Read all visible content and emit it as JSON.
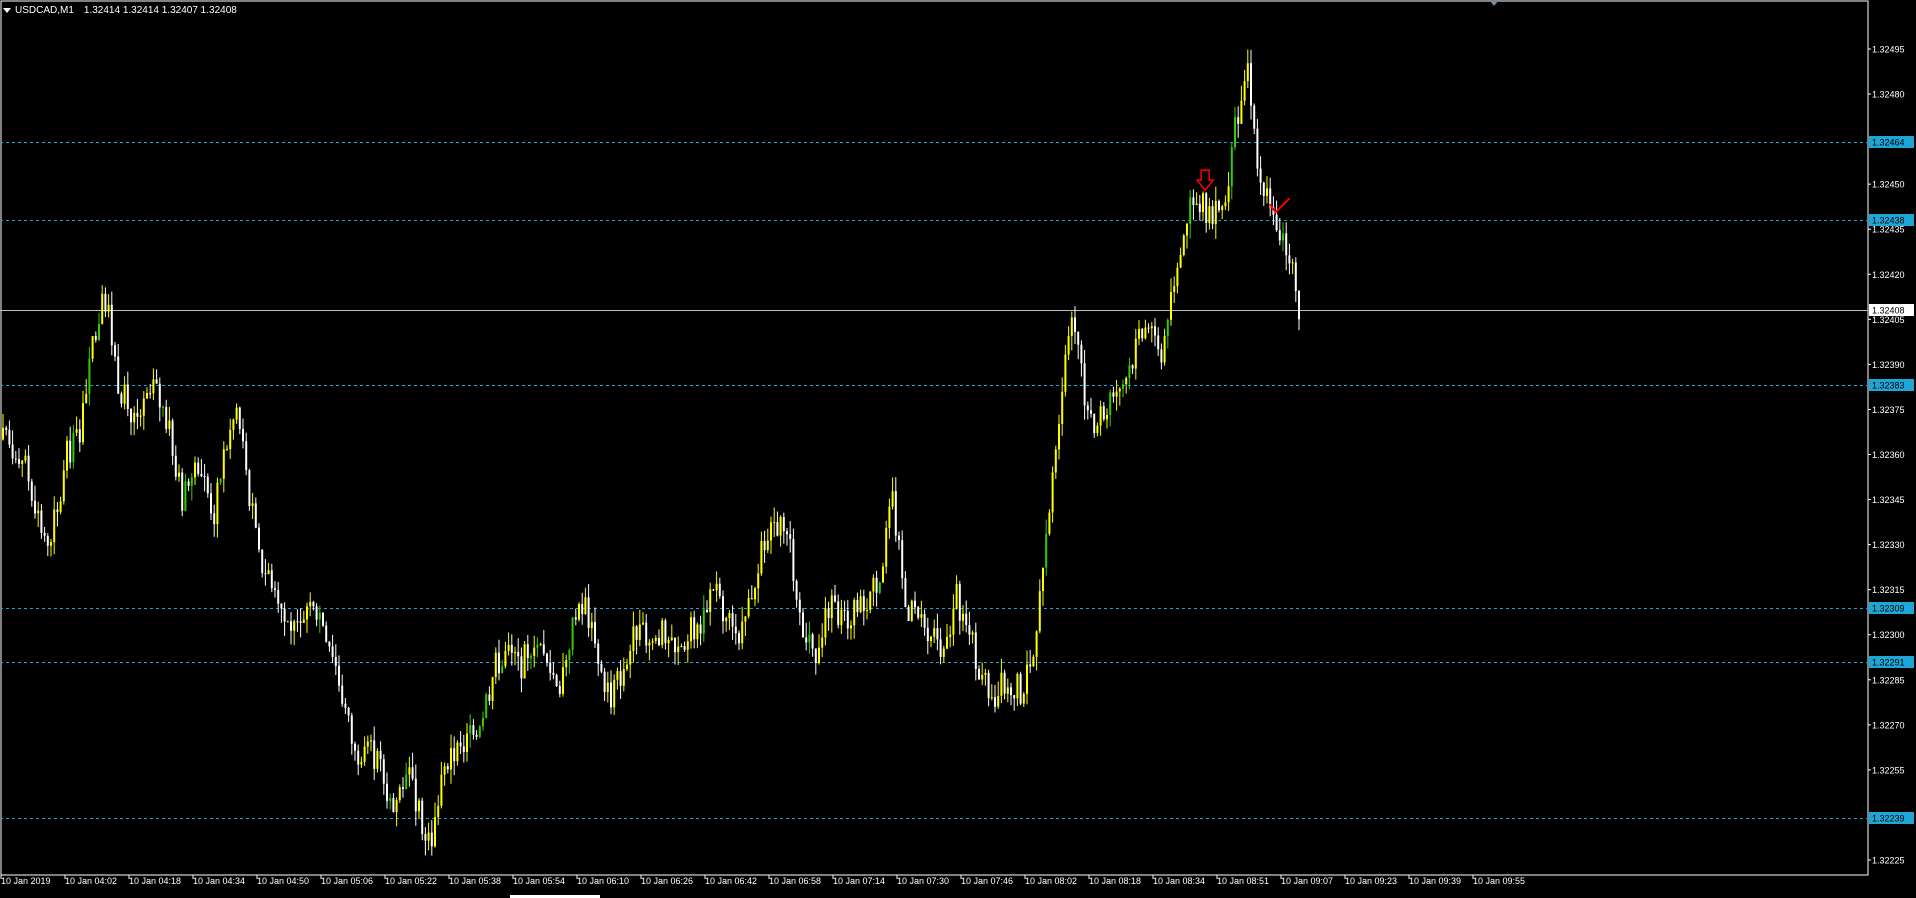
{
  "chart": {
    "symbol_tf": "USDCAD,M1",
    "quote": "1.32414 1.32414 1.32407 1.32408",
    "colors": {
      "background": "#000000",
      "frame": "#ffffff",
      "text": "#ffffff",
      "bull": "#ffff00",
      "bull_alt": "#33cc00",
      "bear": "#ffffff",
      "level_line": "#1ea7d6",
      "level_label_bg": "#1ea7d6",
      "level_label_text": "#000000",
      "current_line": "#bfbfbf",
      "arrow": "#ff0000"
    },
    "price_axis": [
      "1.32495",
      "1.32480",
      "1.32450",
      "1.32435",
      "1.32420",
      "1.32405",
      "1.32390",
      "1.32375",
      "1.32360",
      "1.32345",
      "1.32330",
      "1.32315",
      "1.32300",
      "1.32285",
      "1.32270",
      "1.32255",
      "1.32225"
    ],
    "levels": [
      {
        "label": "1.32464",
        "price": 1.32464
      },
      {
        "label": "1.32438",
        "price": 1.32438
      },
      {
        "label": "1.32383",
        "price": 1.32383
      },
      {
        "label": "1.32309",
        "price": 1.32309
      },
      {
        "label": "1.32291",
        "price": 1.32291
      },
      {
        "label": "1.32239",
        "price": 1.32239
      }
    ],
    "current_price": {
      "label": "1.32408",
      "price": 1.32408
    },
    "time_axis": [
      "10 Jan 2019",
      "10 Jan 04:02",
      "10 Jan 04:18",
      "10 Jan 04:34",
      "10 Jan 04:50",
      "10 Jan 05:06",
      "10 Jan 05:22",
      "10 Jan 05:38",
      "10 Jan 05:54",
      "10 Jan 06:10",
      "10 Jan 06:26",
      "10 Jan 06:42",
      "10 Jan 06:58",
      "10 Jan 07:14",
      "10 Jan 07:30",
      "10 Jan 07:46",
      "10 Jan 08:02",
      "10 Jan 08:18",
      "10 Jan 08:34",
      "10 Jan 08:51",
      "10 Jan 09:07",
      "10 Jan 09:23",
      "10 Jan 09:39",
      "10 Jan 09:55"
    ],
    "price_path": [
      [
        0,
        1.32365
      ],
      [
        6,
        1.3236
      ],
      [
        10,
        1.32345
      ],
      [
        13,
        1.3233
      ],
      [
        17,
        1.3234
      ],
      [
        20,
        1.3236
      ],
      [
        24,
        1.32368
      ],
      [
        28,
        1.324
      ],
      [
        32,
        1.32412
      ],
      [
        36,
        1.32385
      ],
      [
        40,
        1.32372
      ],
      [
        44,
        1.32375
      ],
      [
        47,
        1.32383
      ],
      [
        51,
        1.32372
      ],
      [
        56,
        1.32345
      ],
      [
        61,
        1.32358
      ],
      [
        66,
        1.3234
      ],
      [
        69,
        1.3236
      ],
      [
        73,
        1.32375
      ],
      [
        76,
        1.32355
      ],
      [
        80,
        1.32325
      ],
      [
        85,
        1.32318
      ],
      [
        88,
        1.32305
      ],
      [
        92,
        1.323
      ],
      [
        96,
        1.32315
      ],
      [
        100,
        1.32305
      ],
      [
        103,
        1.32295
      ],
      [
        106,
        1.3228
      ],
      [
        110,
        1.3226
      ],
      [
        114,
        1.32265
      ],
      [
        118,
        1.32255
      ],
      [
        122,
        1.32242
      ],
      [
        126,
        1.32255
      ],
      [
        130,
        1.3224
      ],
      [
        134,
        1.32232
      ],
      [
        138,
        1.32255
      ],
      [
        142,
        1.32262
      ],
      [
        146,
        1.32265
      ],
      [
        150,
        1.32275
      ],
      [
        154,
        1.3229
      ],
      [
        158,
        1.32295
      ],
      [
        162,
        1.3229
      ],
      [
        166,
        1.323
      ],
      [
        170,
        1.3229
      ],
      [
        174,
        1.32284
      ],
      [
        178,
        1.32303
      ],
      [
        182,
        1.3231
      ],
      [
        186,
        1.3229
      ],
      [
        190,
        1.3228
      ],
      [
        194,
        1.3229
      ],
      [
        198,
        1.32302
      ],
      [
        202,
        1.32298
      ],
      [
        206,
        1.323
      ],
      [
        210,
        1.32293
      ],
      [
        214,
        1.323
      ],
      [
        218,
        1.32305
      ],
      [
        222,
        1.32316
      ],
      [
        226,
        1.32305
      ],
      [
        230,
        1.32295
      ],
      [
        234,
        1.32315
      ],
      [
        238,
        1.3233
      ],
      [
        242,
        1.32336
      ],
      [
        246,
        1.3233
      ],
      [
        250,
        1.323
      ],
      [
        254,
        1.32295
      ],
      [
        258,
        1.3231
      ],
      [
        262,
        1.32305
      ],
      [
        266,
        1.32308
      ],
      [
        270,
        1.32312
      ],
      [
        274,
        1.3232
      ],
      [
        278,
        1.32345
      ],
      [
        282,
        1.3231
      ],
      [
        286,
        1.32306
      ],
      [
        290,
        1.323
      ],
      [
        294,
        1.32292
      ],
      [
        298,
        1.32312
      ],
      [
        302,
        1.323
      ],
      [
        306,
        1.32286
      ],
      [
        310,
        1.3228
      ],
      [
        314,
        1.32285
      ],
      [
        318,
        1.32282
      ],
      [
        322,
        1.3229
      ],
      [
        326,
        1.3233
      ],
      [
        330,
        1.32375
      ],
      [
        334,
        1.3241
      ],
      [
        338,
        1.32378
      ],
      [
        342,
        1.3237
      ],
      [
        346,
        1.3238
      ],
      [
        350,
        1.32385
      ],
      [
        354,
        1.32395
      ],
      [
        358,
        1.32405
      ],
      [
        362,
        1.32395
      ],
      [
        366,
        1.3242
      ],
      [
        370,
        1.3244
      ],
      [
        374,
        1.32445
      ],
      [
        378,
        1.32438
      ],
      [
        382,
        1.32445
      ],
      [
        386,
        1.32475
      ],
      [
        389,
        1.3249
      ],
      [
        393,
        1.3245
      ],
      [
        397,
        1.3244
      ],
      [
        401,
        1.3243
      ],
      [
        405,
        1.32408
      ]
    ],
    "arrows": [
      {
        "type": "down-arrow",
        "index": 376,
        "price": 1.32448
      },
      {
        "type": "check-mark",
        "index": 398,
        "price": 1.32442
      }
    ]
  }
}
